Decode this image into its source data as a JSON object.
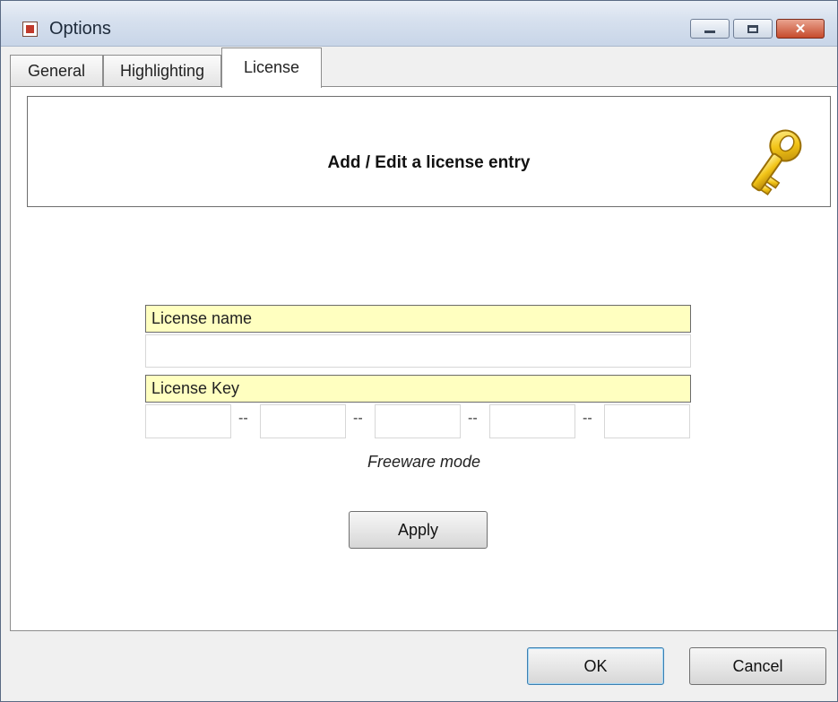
{
  "window": {
    "title": "Options",
    "app_icon": "options-checkbox-icon"
  },
  "controls": {
    "minimize": "minimize-icon",
    "maximize": "maximize-icon",
    "close": "close-icon"
  },
  "tabs": [
    {
      "label": "General",
      "active": false
    },
    {
      "label": "Highlighting",
      "active": false
    },
    {
      "label": "License",
      "active": true
    }
  ],
  "license": {
    "header_title": "Add / Edit a license entry",
    "header_icon": "key-icon",
    "name_label": "License name",
    "name_value": "",
    "key_label": "License Key",
    "key_segments": [
      "",
      "",
      "",
      "",
      ""
    ],
    "separator": "--",
    "mode_text": "Freeware mode",
    "apply_label": "Apply"
  },
  "footer": {
    "ok_label": "OK",
    "cancel_label": "Cancel"
  },
  "colors": {
    "label_fill": "#ffffc0",
    "titlebar": "#d6e0ee",
    "close_button": "#c64b2c"
  }
}
